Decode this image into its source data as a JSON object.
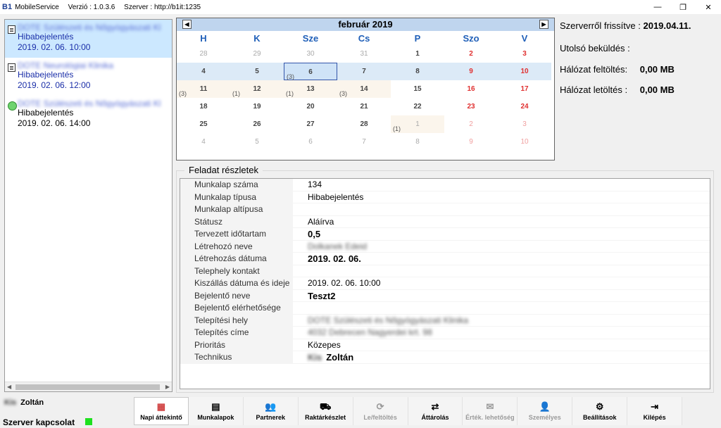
{
  "titlebar": {
    "logo": "B1",
    "app_name": "MobileService",
    "version": "Verzió : 1.0.3.6",
    "server": "Szerver : http://b1it:1235",
    "minimize": "—",
    "restore": "❐",
    "close": "✕"
  },
  "tasks": [
    {
      "name": "DOTE Szülészeti és Nőgyógyászati Kl",
      "type": "Hibabejelentés",
      "date": "2019. 02. 06.   10:00"
    },
    {
      "name": "DOTE Neurológiai Klinika",
      "type": "Hibabejelentés",
      "date": "2019. 02. 06.   12:00"
    },
    {
      "name": "DOTE Szülészeti és Nőgyógyászati Kl",
      "type": "Hibabejelentés",
      "date": "2019. 02. 06.   14:00"
    }
  ],
  "calendar": {
    "month_label": "február 2019",
    "prev": "◀",
    "next": "▶",
    "weekdays": [
      "H",
      "K",
      "Sze",
      "Cs",
      "P",
      "Szo",
      "V"
    ],
    "days": [
      {
        "d": "28",
        "other": true
      },
      {
        "d": "29",
        "other": true
      },
      {
        "d": "30",
        "other": true
      },
      {
        "d": "31",
        "other": true
      },
      {
        "d": "1"
      },
      {
        "d": "2",
        "we": true
      },
      {
        "d": "3",
        "we": true
      },
      {
        "d": "4"
      },
      {
        "d": "5"
      },
      {
        "d": "6",
        "sel": true,
        "cnt": "(3)"
      },
      {
        "d": "7"
      },
      {
        "d": "8"
      },
      {
        "d": "9",
        "we": true
      },
      {
        "d": "10",
        "we": true
      },
      {
        "d": "11",
        "cnt": "(3)"
      },
      {
        "d": "12",
        "cnt": "(1)"
      },
      {
        "d": "13",
        "cnt": "(1)"
      },
      {
        "d": "14",
        "cnt": "(3)"
      },
      {
        "d": "15"
      },
      {
        "d": "16",
        "we": true
      },
      {
        "d": "17",
        "we": true
      },
      {
        "d": "18"
      },
      {
        "d": "19"
      },
      {
        "d": "20"
      },
      {
        "d": "21"
      },
      {
        "d": "22"
      },
      {
        "d": "23",
        "we": true
      },
      {
        "d": "24",
        "we": true
      },
      {
        "d": "25"
      },
      {
        "d": "26"
      },
      {
        "d": "27"
      },
      {
        "d": "28"
      },
      {
        "d": "1",
        "other": true,
        "cnt": "(1)"
      },
      {
        "d": "2",
        "other": true,
        "we": true
      },
      {
        "d": "3",
        "other": true,
        "we": true
      },
      {
        "d": "4",
        "other": true
      },
      {
        "d": "5",
        "other": true
      },
      {
        "d": "6",
        "other": true
      },
      {
        "d": "7",
        "other": true
      },
      {
        "d": "8",
        "other": true
      },
      {
        "d": "9",
        "other": true,
        "we": true
      },
      {
        "d": "10",
        "other": true,
        "we": true
      }
    ]
  },
  "stats": {
    "refresh_label": "Szerverről frissítve :",
    "refresh_value": "2019.04.11.",
    "last_send_label": "Utolsó beküldés :",
    "upload_label": "Hálózat feltöltés:",
    "upload_value": "0,00 MB",
    "download_label": "Hálózat letöltés :",
    "download_value": "0,00 MB"
  },
  "details": {
    "legend": "Feladat részletek",
    "rows": [
      {
        "label": "Munkalap száma",
        "value": "134"
      },
      {
        "label": "Munkalap típusa",
        "value": "Hibabejelentés"
      },
      {
        "label": "Munkalap altípusa",
        "value": ""
      },
      {
        "label": "Státusz",
        "value": "Aláírva"
      },
      {
        "label": "Tervezett időtartam",
        "value": "0,5",
        "bold": true
      },
      {
        "label": "Létrehozó neve",
        "value": "Dolkanek Edeid",
        "blur": true
      },
      {
        "label": "Létrehozás dátuma",
        "value": "2019. 02. 06.",
        "bold": true
      },
      {
        "label": "Telephely kontakt",
        "value": ""
      },
      {
        "label": "Kiszállás dátuma és ideje",
        "value": "2019. 02. 06.   10:00"
      },
      {
        "label": "Bejelentő neve",
        "value": "Teszt2",
        "bold": true
      },
      {
        "label": "Bejelentő elérhetősége",
        "value": ""
      },
      {
        "label": "Telepítési hely",
        "value": "DOTE Szülészeti és Nőgyógyászati Klinika",
        "blur": true
      },
      {
        "label": "Telepítés címe",
        "value": "4032 Debrecen Nagyerdei krt. 98",
        "blur": true
      },
      {
        "label": "Prioritás",
        "value": "Közepes"
      },
      {
        "label": "Technikus",
        "value": "Zoltán",
        "bold": true,
        "prefix_blur": "Kis"
      }
    ]
  },
  "user": {
    "surname": "Kis",
    "name": "Zoltán"
  },
  "status": {
    "label": "Szerver kapcsolat",
    "color": "#1ee01e"
  },
  "toolbar": [
    {
      "label": "Napi áttekintő",
      "icon": "calendar-icon",
      "glyph": "▦",
      "active": true
    },
    {
      "label": "Munkalapok",
      "icon": "documents-icon",
      "glyph": "▤"
    },
    {
      "label": "Partnerek",
      "icon": "users-icon",
      "glyph": "👥"
    },
    {
      "label": "Raktárkészlet",
      "icon": "truck-icon",
      "glyph": "⛟"
    },
    {
      "label": "Le/feltöltés",
      "icon": "sync-icon",
      "glyph": "⟳",
      "disabled": true
    },
    {
      "label": "Áttárolás",
      "icon": "transfer-icon",
      "glyph": "⇄"
    },
    {
      "label": "Érték. lehetőség",
      "icon": "chat-icon",
      "glyph": "✉",
      "disabled": true
    },
    {
      "label": "Személyes",
      "icon": "person-icon",
      "glyph": "👤",
      "disabled": true
    },
    {
      "label": "Beállítások",
      "icon": "gear-icon",
      "glyph": "⚙"
    },
    {
      "label": "Kilépés",
      "icon": "exit-icon",
      "glyph": "⇥"
    }
  ]
}
